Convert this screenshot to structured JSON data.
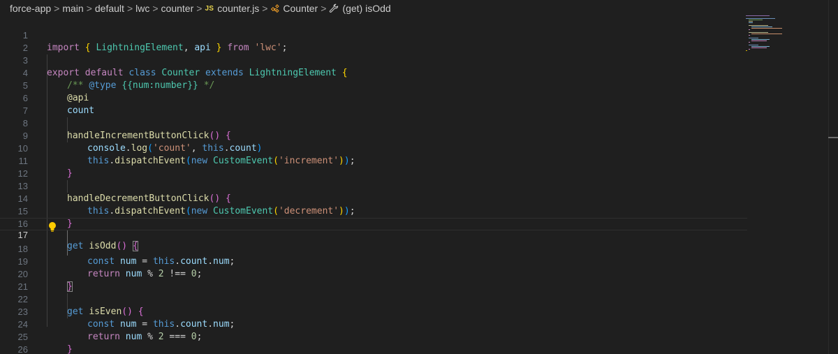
{
  "breadcrumb": {
    "items": [
      "force-app",
      "main",
      "default",
      "lwc",
      "counter"
    ],
    "file_badge": "JS",
    "file": "counter.js",
    "class_symbol": "Counter",
    "method_symbol": "(get) isOdd",
    "separator": ">"
  },
  "editor": {
    "line_numbers": [
      "1",
      "2",
      "3",
      "4",
      "5",
      "6",
      "7",
      "8",
      "9",
      "10",
      "11",
      "12",
      "13",
      "14",
      "15",
      "16",
      "17",
      "18",
      "19",
      "20",
      "21",
      "22",
      "23",
      "24",
      "25",
      "26"
    ],
    "active_line": "17"
  },
  "tokens": {
    "import": "import",
    "brace_open": "{",
    "brace_close": "}",
    "lightning_element": "LightningElement",
    "comma": ",",
    "api": "api",
    "from": "from",
    "lwc_str": "'lwc'",
    "semi": ";",
    "export": "export",
    "default": "default",
    "class": "class",
    "counter": "Counter",
    "extends": "extends",
    "doc_open": "/**",
    "doc_type": "@type",
    "doc_type_value": "{{num:number}}",
    "doc_close": "*/",
    "api_decorator": "@api",
    "count": "count",
    "handle_inc": "handleIncrementButtonClick",
    "paren_pair": "()",
    "console": "console",
    "dot": ".",
    "log": "log",
    "paren_open": "(",
    "paren_close": ")",
    "count_str": "'count'",
    "this": "this",
    "dispatch_event": "dispatchEvent",
    "new": "new",
    "custom_event": "CustomEvent",
    "increment_str": "'increment'",
    "handle_dec": "handleDecrementButtonClick",
    "decrement_str": "'decrement'",
    "get": "get",
    "is_odd": "isOdd",
    "const": "const",
    "num_var": "num",
    "assign": "=",
    "num_prop": "num",
    "return": "return",
    "mod": "%",
    "two": "2",
    "strict_neq": "!==",
    "zero": "0",
    "is_even": "isEven",
    "strict_eq": "==="
  },
  "colors": {
    "background": "#1f1f1f",
    "keyword": "#569cd6",
    "control": "#c586c0",
    "class_name": "#4ec9b0",
    "function": "#dcdcaa",
    "variable": "#9cdcfe",
    "string": "#ce9178",
    "comment": "#6a9955",
    "bracket_1": "#ffd700",
    "bracket_2": "#da70d6",
    "bracket_3": "#179fff"
  },
  "icons": {
    "class_icon": "symbol-class-icon",
    "method_icon": "symbol-method-icon",
    "lightbulb": "lightbulb-icon"
  }
}
